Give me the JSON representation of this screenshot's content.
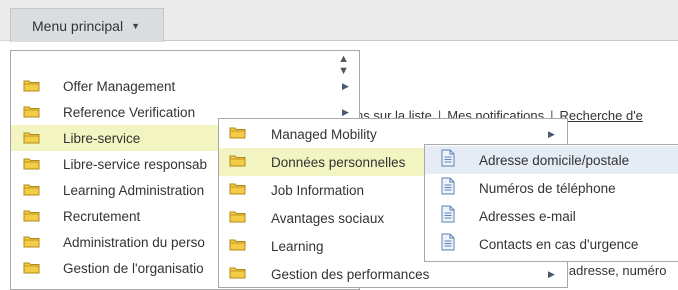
{
  "menu_button": {
    "label": "Menu principal"
  },
  "background": {
    "links": [
      "ns sur la liste",
      "Mes notifications",
      "Recherche d'e"
    ],
    "separator": "|",
    "bottom_text": "adresse, numéro"
  },
  "menu1": {
    "items": [
      {
        "label": "Offer Management",
        "submenu": true
      },
      {
        "label": "Reference Verification",
        "submenu": true
      },
      {
        "label": "Libre-service",
        "submenu": true,
        "selected": true
      },
      {
        "label": "Libre-service responsab",
        "submenu": false
      },
      {
        "label": "Learning Administration",
        "submenu": false
      },
      {
        "label": "Recrutement",
        "submenu": false
      },
      {
        "label": "Administration du perso",
        "submenu": false
      },
      {
        "label": "Gestion de l'organisatio",
        "submenu": false
      }
    ]
  },
  "menu2": {
    "items": [
      {
        "label": "Managed Mobility",
        "submenu": true
      },
      {
        "label": "Données personnelles",
        "submenu": true,
        "selected": true
      },
      {
        "label": "Job Information",
        "submenu": false
      },
      {
        "label": "Avantages sociaux",
        "submenu": false
      },
      {
        "label": "Learning",
        "submenu": false
      },
      {
        "label": "Gestion des performances",
        "submenu": true
      }
    ]
  },
  "menu3": {
    "items": [
      {
        "label": "Adresse domicile/postale",
        "selected": true
      },
      {
        "label": "Numéros de téléphone"
      },
      {
        "label": "Adresses e-mail"
      },
      {
        "label": "Contacts en cas d'urgence"
      }
    ]
  },
  "colors": {
    "selected_row": "#f2f5c2",
    "selected_leaf": "#e6ecf5",
    "folder_fill": "#f5cc45",
    "folder_stroke": "#b08a1a",
    "topbar": "#ebebeb"
  },
  "icons": {
    "folder": "folder-icon",
    "document": "document-icon",
    "submenu": "chevron-right-icon",
    "menu": "caret-down-icon"
  }
}
